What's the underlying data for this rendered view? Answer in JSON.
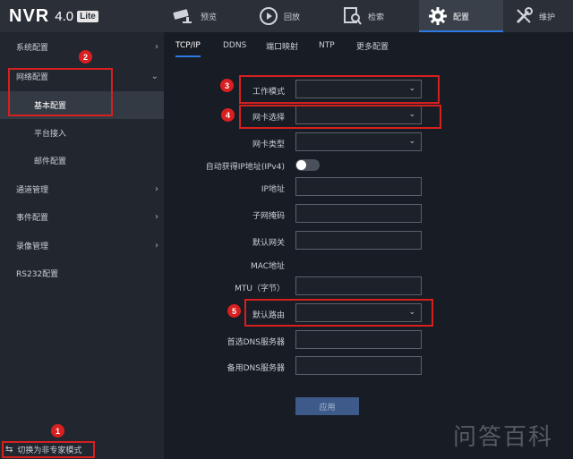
{
  "app": {
    "brand": "NVR",
    "version": "4.0",
    "edition": "Lite"
  },
  "nav": [
    {
      "label": "预览",
      "icon": "camera-icon"
    },
    {
      "label": "回放",
      "icon": "playback-icon"
    },
    {
      "label": "检索",
      "icon": "search-icon"
    },
    {
      "label": "配置",
      "icon": "gear-icon"
    },
    {
      "label": "维护",
      "icon": "wrench-icon"
    }
  ],
  "sidebar": {
    "items": [
      {
        "label": "系统配置",
        "chevron": "›"
      },
      {
        "label": "网络配置",
        "chevron": "⌄"
      },
      {
        "label": "基本配置"
      },
      {
        "label": "平台接入"
      },
      {
        "label": "邮件配置"
      },
      {
        "label": "通道管理",
        "chevron": "›"
      },
      {
        "label": "事件配置",
        "chevron": "›"
      },
      {
        "label": "录像管理",
        "chevron": "›"
      },
      {
        "label": "RS232配置"
      }
    ],
    "mode_switch": "切换为非专家模式"
  },
  "tabs": [
    "TCP/IP",
    "DDNS",
    "端口映射",
    "NTP",
    "更多配置"
  ],
  "form": {
    "work_mode": "工作模式",
    "nic_select": "网卡选择",
    "nic_type": "网卡类型",
    "dhcp": "自动获得IP地址(IPv4)",
    "ip": "IP地址",
    "mask": "子网掩码",
    "gateway": "默认网关",
    "mac": "MAC地址",
    "mtu": "MTU（字节）",
    "default_route": "默认路由",
    "dns_primary": "首选DNS服务器",
    "dns_secondary": "备用DNS服务器",
    "apply": "应用"
  },
  "badges": [
    "1",
    "2",
    "3",
    "4",
    "5"
  ],
  "watermark": "问答百科",
  "colors": {
    "accent": "#2f7ae5",
    "annotation": "#d62020",
    "background": "#181c24"
  }
}
